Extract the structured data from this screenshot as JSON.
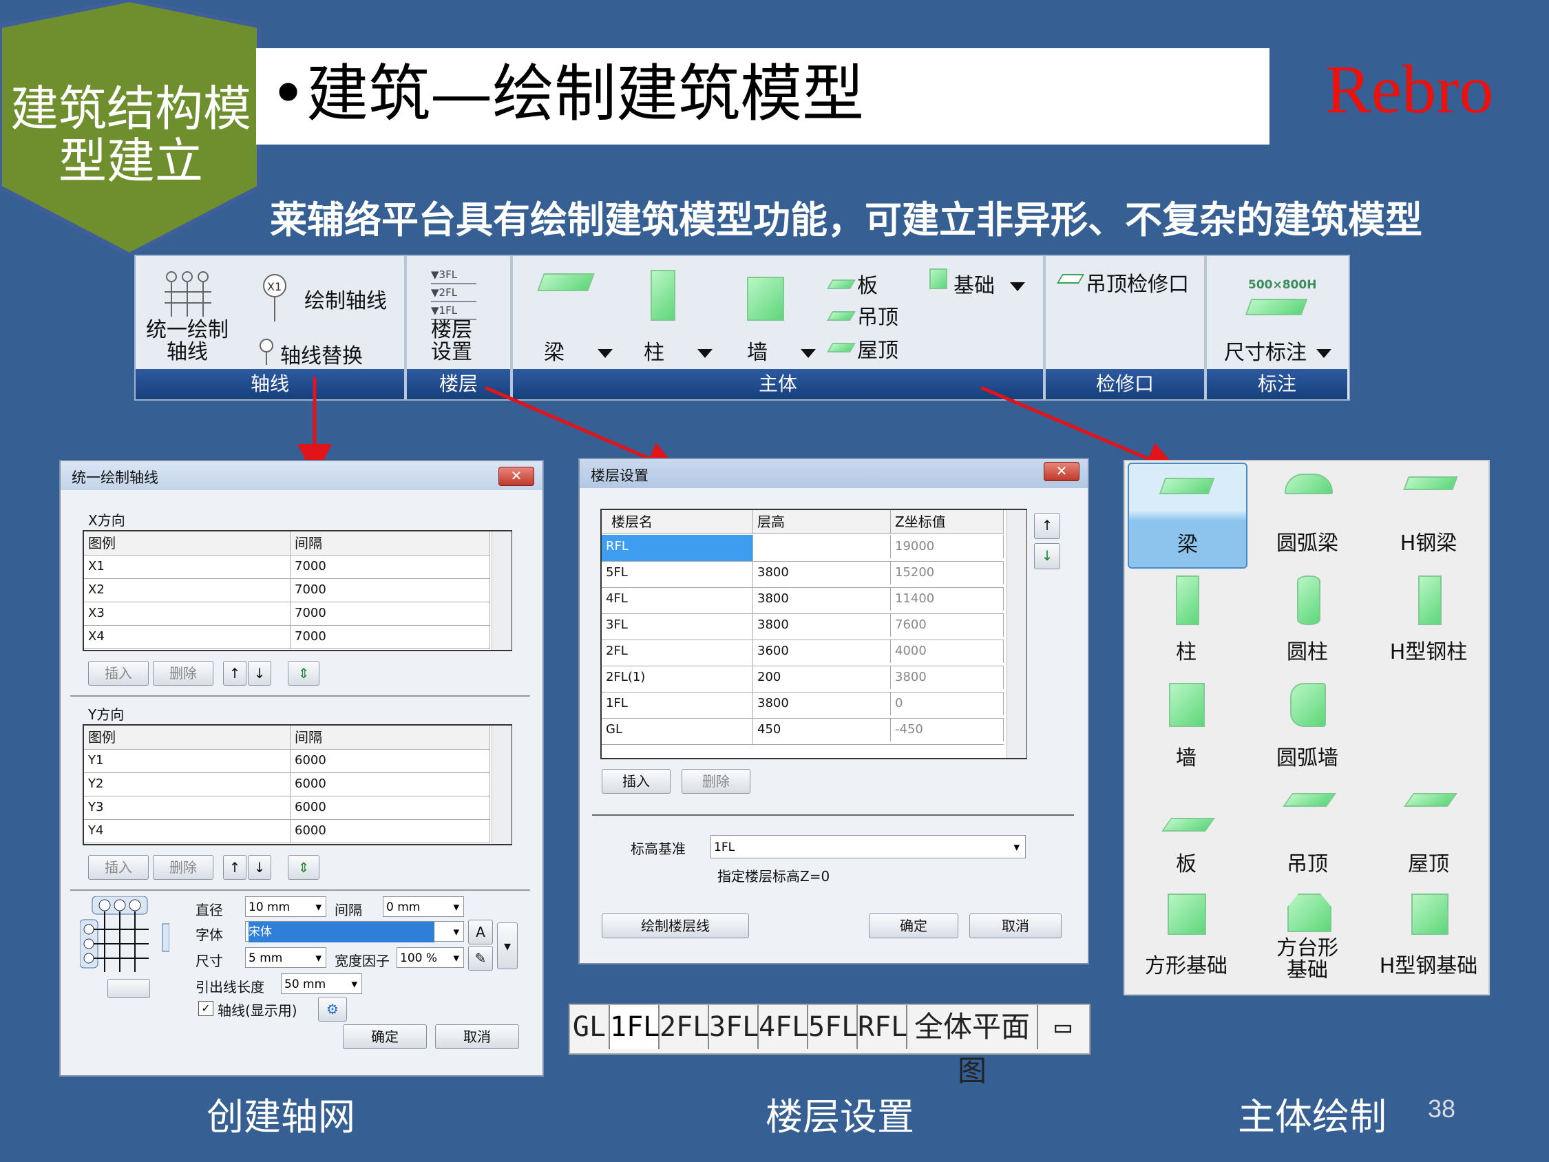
{
  "badge": {
    "line1": "建筑结构模",
    "line2": "型建立"
  },
  "header": {
    "title": "•建筑—绘制建筑模型",
    "brand": "Rebro"
  },
  "subtitle": "莱辅络平台具有绘制建筑模型功能，可建立非异形、不复杂的建筑模型",
  "ribbon": {
    "groups": [
      {
        "name": "轴线",
        "items": [
          "统一绘制\n轴线",
          "绘制轴线",
          "轴线替换"
        ]
      },
      {
        "name": "楼层",
        "items": [
          "楼层\n设置"
        ],
        "icon_labels": [
          "▼3FL",
          "▼2FL",
          "▼1FL"
        ]
      },
      {
        "name": "主体",
        "items": [
          "梁",
          "柱",
          "墙",
          "板",
          "吊顶",
          "屋顶",
          "基础"
        ]
      },
      {
        "name": "检修口",
        "items": [
          "吊顶检修口"
        ]
      },
      {
        "name": "标注",
        "items": [
          "尺寸标注"
        ],
        "icon_label": "500×800H"
      }
    ]
  },
  "axis_dialog": {
    "title": "统一绘制轴线",
    "x_section": "X方向",
    "y_section": "Y方向",
    "col_legend": "图例",
    "col_spacing": "间隔",
    "x_rows": [
      [
        "X1",
        "7000"
      ],
      [
        "X2",
        "7000"
      ],
      [
        "X3",
        "7000"
      ],
      [
        "X4",
        "7000"
      ]
    ],
    "y_rows": [
      [
        "Y1",
        "6000"
      ],
      [
        "Y2",
        "6000"
      ],
      [
        "Y3",
        "6000"
      ],
      [
        "Y4",
        "6000"
      ]
    ],
    "insert": "插入",
    "delete": "删除",
    "diameter_label": "直径",
    "diameter_value": "10 mm",
    "gap_label": "间隔",
    "gap_value": "0 mm",
    "font_label": "字体",
    "font_value": "宋体",
    "size_label": "尺寸",
    "size_value": "5 mm",
    "width_factor_label": "宽度因子",
    "width_factor_value": "100 %",
    "leader_label": "引出线长度",
    "leader_value": "50 mm",
    "checkbox_label": "轴线(显示用)",
    "ok": "确定",
    "cancel": "取消"
  },
  "floor_dialog": {
    "title": "楼层设置",
    "columns": [
      "楼层名",
      "层高",
      "Z坐标值"
    ],
    "rows": [
      [
        "RFL",
        "",
        "19000"
      ],
      [
        "5FL",
        "3800",
        "15200"
      ],
      [
        "4FL",
        "3800",
        "11400"
      ],
      [
        "3FL",
        "3800",
        "7600"
      ],
      [
        "2FL",
        "3600",
        "4000"
      ],
      [
        "2FL(1)",
        "200",
        "3800"
      ],
      [
        "1FL",
        "3800",
        "0"
      ],
      [
        "GL",
        "450",
        "-450"
      ]
    ],
    "insert": "插入",
    "delete": "删除",
    "base_label": "标高基准",
    "base_value": "1FL",
    "hint": "指定楼层标高Z=0",
    "draw_lines": "绘制楼层线",
    "ok": "确定",
    "cancel": "取消"
  },
  "floor_tabs": [
    "GL",
    "1FL",
    "2FL",
    "3FL",
    "4FL",
    "5FL",
    "RFL",
    "全体平面图"
  ],
  "palette": {
    "items": [
      "梁",
      "圆弧梁",
      "H钢梁",
      "柱",
      "圆柱",
      "H型钢柱",
      "墙",
      "圆弧墙",
      "板",
      "吊顶",
      "屋顶",
      "方形基础",
      "方台形\n基础",
      "H型钢基础"
    ]
  },
  "captions": {
    "left": "创建轴网",
    "middle": "楼层设置",
    "right": "主体绘制"
  },
  "page_number": "38",
  "colors": {
    "background": "#365f93",
    "badge": "#6f8e2e",
    "brand": "#e8120e",
    "arrow": "#e0141a",
    "selected": "#8cc4ee"
  }
}
